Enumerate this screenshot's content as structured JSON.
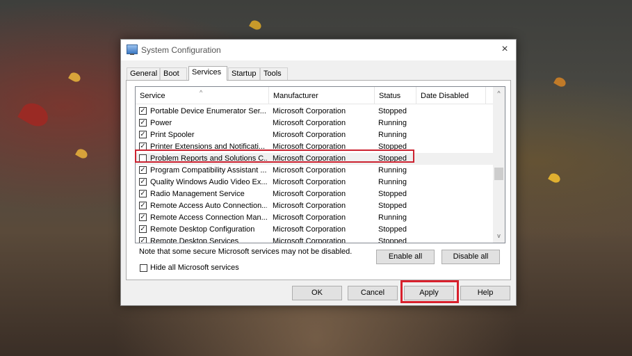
{
  "window": {
    "title": "System Configuration"
  },
  "tabs": [
    {
      "label": "General"
    },
    {
      "label": "Boot"
    },
    {
      "label": "Services"
    },
    {
      "label": "Startup"
    },
    {
      "label": "Tools"
    }
  ],
  "table": {
    "columns": [
      "Service",
      "Manufacturer",
      "Status",
      "Date Disabled"
    ],
    "rows": [
      {
        "service": "Portable Device Enumerator Ser...",
        "manufacturer": "Microsoft Corporation",
        "status": "Stopped",
        "checked": "✓"
      },
      {
        "service": "Power",
        "manufacturer": "Microsoft Corporation",
        "status": "Running",
        "checked": "✓"
      },
      {
        "service": "Print Spooler",
        "manufacturer": "Microsoft Corporation",
        "status": "Running",
        "checked": "✓"
      },
      {
        "service": "Printer Extensions and Notificati...",
        "manufacturer": "Microsoft Corporation",
        "status": "Stopped",
        "checked": "✓"
      },
      {
        "service": "Problem Reports and Solutions C...",
        "manufacturer": "Microsoft Corporation",
        "status": "Stopped",
        "checked": ""
      },
      {
        "service": "Program Compatibility Assistant ...",
        "manufacturer": "Microsoft Corporation",
        "status": "Running",
        "checked": "✓"
      },
      {
        "service": "Quality Windows Audio Video Ex...",
        "manufacturer": "Microsoft Corporation",
        "status": "Running",
        "checked": "✓"
      },
      {
        "service": "Radio Management Service",
        "manufacturer": "Microsoft Corporation",
        "status": "Stopped",
        "checked": "✓"
      },
      {
        "service": "Remote Access Auto Connection...",
        "manufacturer": "Microsoft Corporation",
        "status": "Stopped",
        "checked": "✓"
      },
      {
        "service": "Remote Access Connection Man...",
        "manufacturer": "Microsoft Corporation",
        "status": "Running",
        "checked": "✓"
      },
      {
        "service": "Remote Desktop Configuration",
        "manufacturer": "Microsoft Corporation",
        "status": "Stopped",
        "checked": "✓"
      },
      {
        "service": "Remote Desktop Services",
        "manufacturer": "Microsoft Corporation",
        "status": "Stopped",
        "checked": "✓"
      }
    ]
  },
  "note": "Note that some secure Microsoft services may not be disabled.",
  "buttons": {
    "enable_all": "Enable all",
    "disable_all": "Disable all",
    "ok": "OK",
    "cancel": "Cancel",
    "apply": "Apply",
    "help": "Help"
  },
  "hide_all": {
    "label": "Hide all Microsoft services",
    "checked": ""
  },
  "icons": {
    "close": "×",
    "scroll_up": "^",
    "scroll_down": "v",
    "sort": "^"
  },
  "colors": {
    "highlight": "#cc2230"
  }
}
